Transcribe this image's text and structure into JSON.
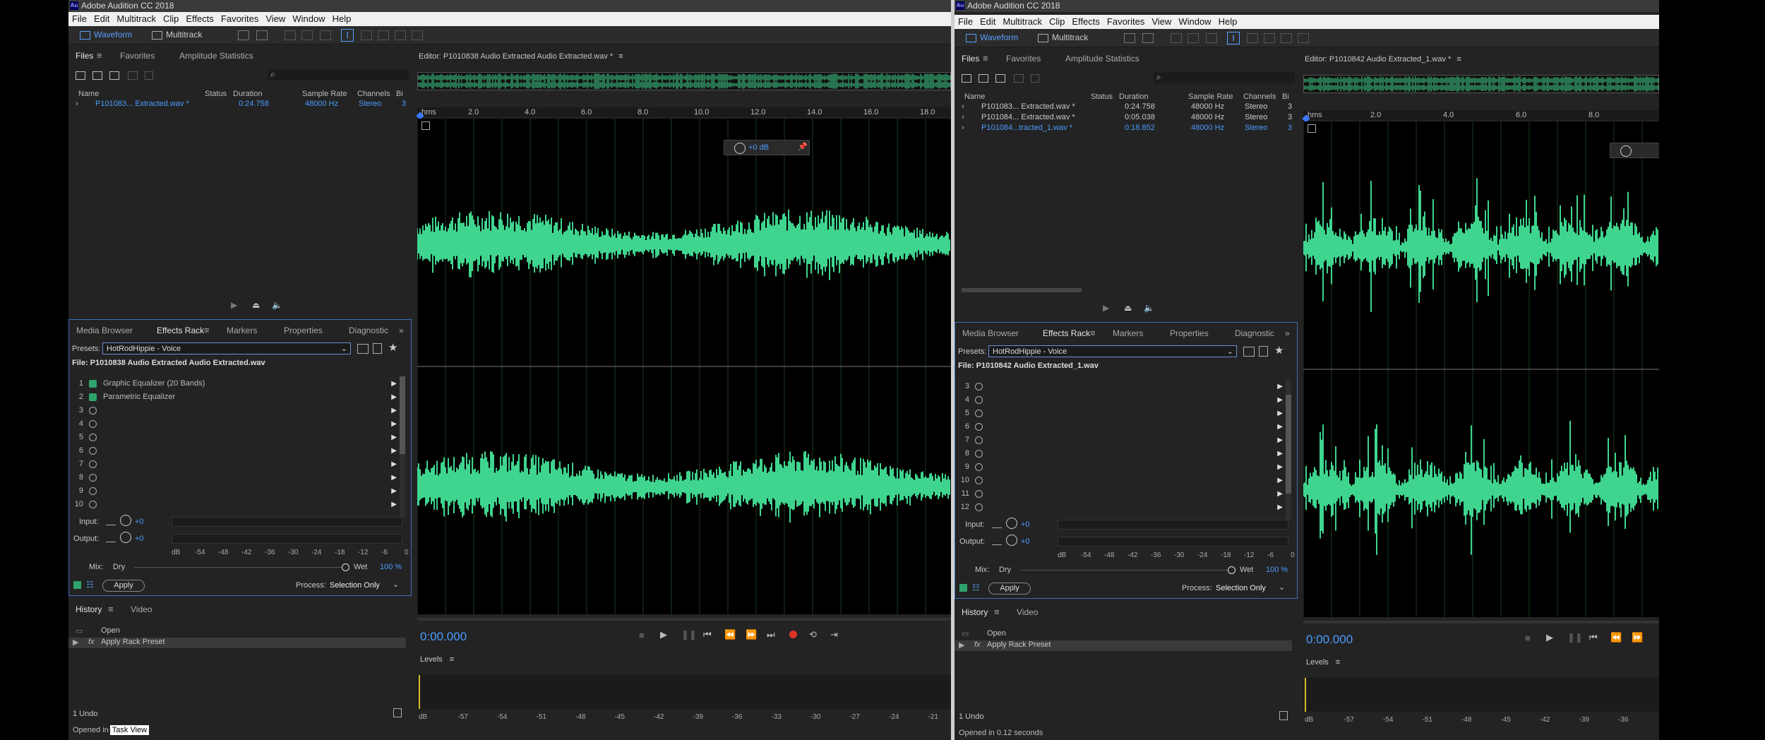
{
  "app_title": "Adobe Audition CC 2018",
  "menu": [
    "File",
    "Edit",
    "Multitrack",
    "Clip",
    "Effects",
    "Favorites",
    "View",
    "Window",
    "Help"
  ],
  "modes": {
    "waveform": "Waveform",
    "multitrack": "Multitrack"
  },
  "left": {
    "files_tabs": [
      "Files",
      "Favorites",
      "Amplitude Statistics"
    ],
    "columns": [
      "Name",
      "Status",
      "Duration",
      "Sample Rate",
      "Channels",
      "Bi"
    ],
    "files": [
      {
        "name": "P101083... Extracted.wav *",
        "status": "",
        "duration": "0:24.758",
        "rate": "48000 Hz",
        "channels": "Stereo",
        "bits": "3"
      }
    ],
    "fx_tabs": [
      "Media Browser",
      "Effects Rack",
      "Markers",
      "Properties",
      "Diagnostic"
    ],
    "presets_label": "Presets:",
    "preset": "HotRodHippie - Voice",
    "file_label": "File: P1010838 Audio Extracted Audio Extracted.wav",
    "slots": [
      {
        "n": "1",
        "name": "Graphic Equalizer (20 Bands)",
        "on": true
      },
      {
        "n": "2",
        "name": "Parametric Equalizer",
        "on": true
      },
      {
        "n": "3",
        "name": ""
      },
      {
        "n": "4",
        "name": ""
      },
      {
        "n": "5",
        "name": ""
      },
      {
        "n": "6",
        "name": ""
      },
      {
        "n": "7",
        "name": ""
      },
      {
        "n": "8",
        "name": ""
      },
      {
        "n": "9",
        "name": ""
      },
      {
        "n": "10",
        "name": ""
      }
    ],
    "input_label": "Input:",
    "output_label": "Output:",
    "gain": "+0",
    "meter_ticks": [
      "dB",
      "-54",
      "-48",
      "-42",
      "-36",
      "-30",
      "-24",
      "-18",
      "-12",
      "-6",
      "0"
    ],
    "mix_label": "Mix:",
    "dry": "Dry",
    "wet": "Wet",
    "wet_value": "100 %",
    "apply": "Apply",
    "process_label": "Process:",
    "process_value": "Selection Only",
    "history_tabs": [
      "History",
      "Video"
    ],
    "history": [
      "Open",
      "Apply Rack Preset"
    ],
    "undo": "1 Undo",
    "status": "Opened in",
    "tooltip": "Task View",
    "editor_title": "Editor: P1010838 Audio Extracted Audio Extracted.wav *",
    "ruler": [
      "hms",
      "2.0",
      "4.0",
      "6.0",
      "8.0",
      "10.0",
      "12.0",
      "14.0",
      "16.0",
      "18.0"
    ],
    "hud_gain": "+0 dB",
    "time": "0:00.000",
    "levels_title": "Levels",
    "level_ticks": [
      "dB",
      "-57",
      "-54",
      "-51",
      "-48",
      "-45",
      "-42",
      "-39",
      "-36",
      "-33",
      "-30",
      "-27",
      "-24",
      "-21"
    ]
  },
  "right": {
    "files_tabs": [
      "Files",
      "Favorites",
      "Amplitude Statistics"
    ],
    "columns": [
      "Name",
      "Status",
      "Duration",
      "Sample Rate",
      "Channels",
      "Bi"
    ],
    "files": [
      {
        "name": "P101083... Extracted.wav *",
        "status": "",
        "duration": "0:24.758",
        "rate": "48000 Hz",
        "channels": "Stereo",
        "bits": "3"
      },
      {
        "name": "P101084... Extracted.wav *",
        "status": "",
        "duration": "0:05.038",
        "rate": "48000 Hz",
        "channels": "Stereo",
        "bits": "3"
      },
      {
        "name": "P101084...tracted_1.wav *",
        "status": "",
        "duration": "0:18.852",
        "rate": "48000 Hz",
        "channels": "Stereo",
        "bits": "3"
      }
    ],
    "fx_tabs": [
      "Media Browser",
      "Effects Rack",
      "Markers",
      "Properties",
      "Diagnostic"
    ],
    "presets_label": "Presets:",
    "preset": "HotRodHippie - Voice",
    "file_label": "File: P1010842 Audio Extracted_1.wav",
    "slots": [
      {
        "n": "3"
      },
      {
        "n": "4"
      },
      {
        "n": "5"
      },
      {
        "n": "6"
      },
      {
        "n": "7"
      },
      {
        "n": "8"
      },
      {
        "n": "9"
      },
      {
        "n": "10"
      },
      {
        "n": "11"
      },
      {
        "n": "12"
      }
    ],
    "input_label": "Input:",
    "output_label": "Output:",
    "gain": "+0",
    "meter_ticks": [
      "dB",
      "-54",
      "-48",
      "-42",
      "-36",
      "-30",
      "-24",
      "-18",
      "-12",
      "-6",
      "0"
    ],
    "mix_label": "Mix:",
    "dry": "Dry",
    "wet": "Wet",
    "wet_value": "100 %",
    "apply": "Apply",
    "process_label": "Process:",
    "process_value": "Selection Only",
    "history_tabs": [
      "History",
      "Video"
    ],
    "history": [
      "Open",
      "Apply Rack Preset"
    ],
    "undo": "1 Undo",
    "status": "Opened in 0.12 seconds",
    "editor_title": "Editor: P1010842 Audio Extracted_1.wav *",
    "ruler": [
      "hms",
      "2.0",
      "4.0",
      "6.0",
      "8.0"
    ],
    "time": "0:00.000",
    "levels_title": "Levels",
    "level_ticks": [
      "dB",
      "-57",
      "-54",
      "-51",
      "-48",
      "-45",
      "-42",
      "-39",
      "-36"
    ]
  },
  "colors": {
    "waveform": "#3fd58f",
    "accent": "#4a9cff",
    "record": "#e0342b"
  }
}
